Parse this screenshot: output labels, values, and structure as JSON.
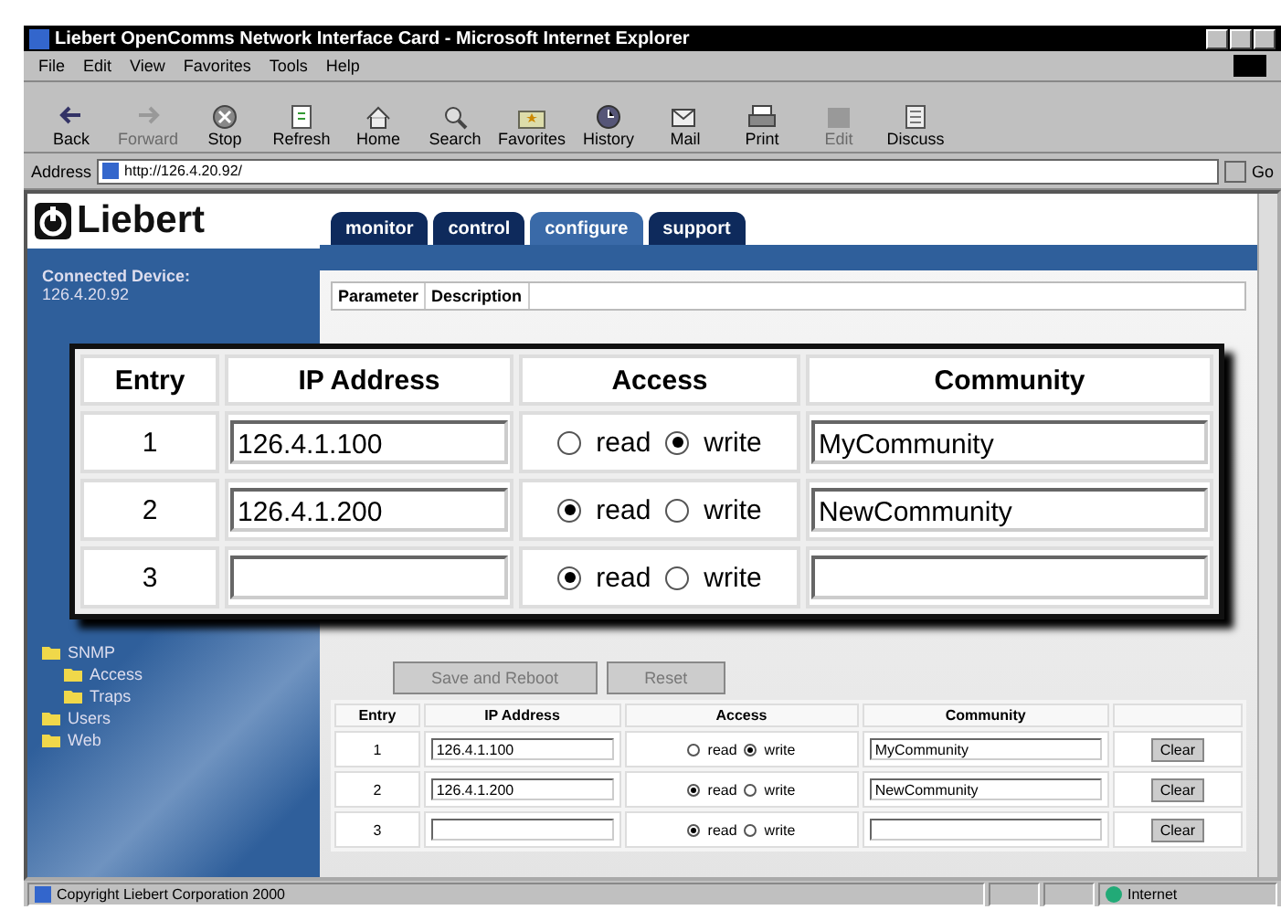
{
  "window": {
    "title": "Liebert OpenComms Network Interface Card - Microsoft Internet Explorer"
  },
  "menu": [
    "File",
    "Edit",
    "View",
    "Favorites",
    "Tools",
    "Help"
  ],
  "toolbar": [
    {
      "label": "Back",
      "disabled": false
    },
    {
      "label": "Forward",
      "disabled": true
    },
    {
      "label": "Stop",
      "disabled": false
    },
    {
      "label": "Refresh",
      "disabled": false
    },
    {
      "label": "Home",
      "disabled": false
    },
    {
      "label": "Search",
      "disabled": false
    },
    {
      "label": "Favorites",
      "disabled": false
    },
    {
      "label": "History",
      "disabled": false
    },
    {
      "label": "Mail",
      "disabled": false
    },
    {
      "label": "Print",
      "disabled": false
    },
    {
      "label": "Edit",
      "disabled": true
    },
    {
      "label": "Discuss",
      "disabled": false
    }
  ],
  "address": {
    "label": "Address",
    "value": "http://126.4.20.92/",
    "go": "Go"
  },
  "logo": "Liebert",
  "tabs": [
    {
      "label": "monitor",
      "selected": false
    },
    {
      "label": "control",
      "selected": false
    },
    {
      "label": "configure",
      "selected": true
    },
    {
      "label": "support",
      "selected": false
    }
  ],
  "sidebar": {
    "heading": "Connected Device:",
    "device": "126.4.20.92",
    "tree": [
      {
        "label": "SNMP",
        "children": [
          {
            "label": "Access"
          },
          {
            "label": "Traps"
          }
        ]
      },
      {
        "label": "Users"
      },
      {
        "label": "Web"
      }
    ]
  },
  "parameter_table": {
    "columns": [
      "Parameter",
      "Description"
    ]
  },
  "buttons": [
    {
      "label": "Save and Reboot",
      "disabled": true
    },
    {
      "label": "Reset",
      "disabled": true
    }
  ],
  "access_table": {
    "columns": [
      "Entry",
      "IP Address",
      "Access",
      "Community"
    ],
    "rows": [
      {
        "entry": "1",
        "ip": "126.4.1.100",
        "options": [
          {
            "label": "read",
            "selected": false
          },
          {
            "label": "write",
            "selected": true
          }
        ],
        "community": "MyCommunity",
        "clear": "Clear"
      },
      {
        "entry": "2",
        "ip": "126.4.1.200",
        "options": [
          {
            "label": "read",
            "selected": true
          },
          {
            "label": "write",
            "selected": false
          }
        ],
        "community": "NewCommunity",
        "clear": "Clear"
      },
      {
        "entry": "3",
        "ip": "",
        "options": [
          {
            "label": "read",
            "selected": true
          },
          {
            "label": "write",
            "selected": false
          }
        ],
        "community": "",
        "clear": "Clear"
      }
    ]
  },
  "callout": {
    "columns": [
      "Entry",
      "IP Address",
      "Access",
      "Community"
    ],
    "rows": [
      {
        "entry": "1",
        "ip": "126.4.1.100",
        "options": [
          {
            "label": "read",
            "selected": false
          },
          {
            "label": "write",
            "selected": true
          }
        ],
        "community": "MyCommunity"
      },
      {
        "entry": "2",
        "ip": "126.4.1.200",
        "options": [
          {
            "label": "read",
            "selected": true
          },
          {
            "label": "write",
            "selected": false
          }
        ],
        "community": "NewCommunity"
      },
      {
        "entry": "3",
        "ip": "",
        "options": [
          {
            "label": "read",
            "selected": true
          },
          {
            "label": "write",
            "selected": false
          }
        ],
        "community": ""
      }
    ]
  },
  "status_bar": {
    "text": "Copyright Liebert Corporation 2000",
    "zone": "Internet"
  }
}
